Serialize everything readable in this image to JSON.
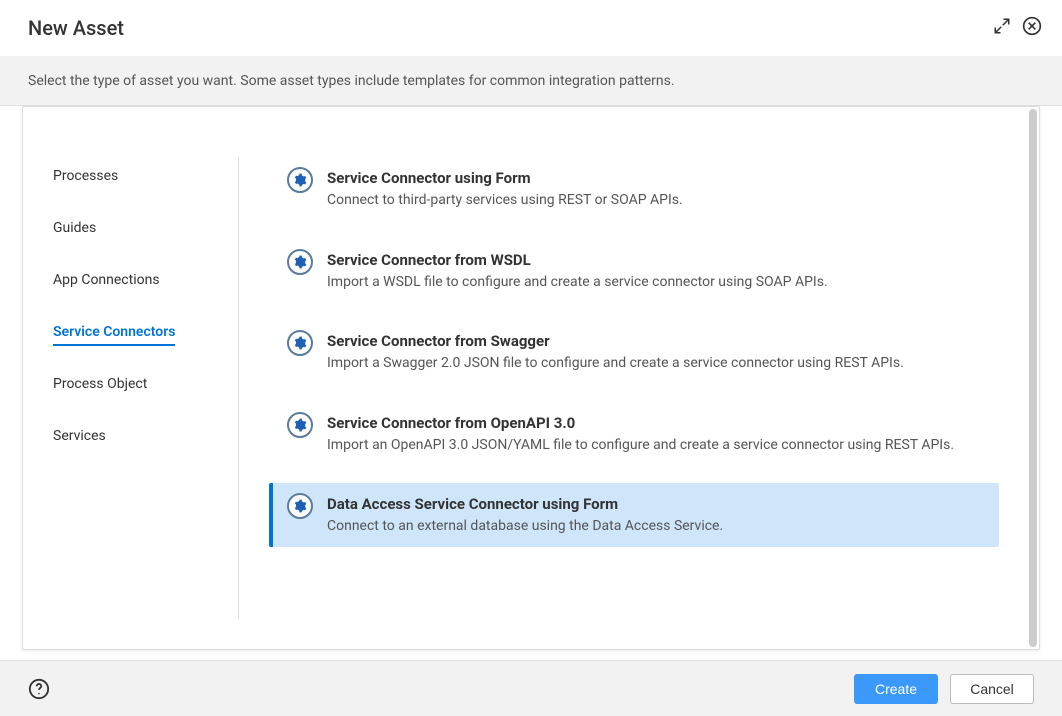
{
  "header": {
    "title": "New Asset"
  },
  "description": "Select the type of asset you want. Some asset types include templates for common integration patterns.",
  "sidebar": {
    "items": [
      {
        "label": "Processes",
        "active": false
      },
      {
        "label": "Guides",
        "active": false
      },
      {
        "label": "App Connections",
        "active": false
      },
      {
        "label": "Service Connectors",
        "active": true
      },
      {
        "label": "Process Object",
        "active": false
      },
      {
        "label": "Services",
        "active": false
      }
    ]
  },
  "items": [
    {
      "title": "Service Connector using Form",
      "desc": "Connect to third-party services using REST or SOAP APIs.",
      "selected": false
    },
    {
      "title": "Service Connector from WSDL",
      "desc": "Import a WSDL file to configure and create a service connector using SOAP APIs.",
      "selected": false
    },
    {
      "title": "Service Connector from Swagger",
      "desc": "Import a Swagger 2.0 JSON file to configure and create a service connector using REST APIs.",
      "selected": false
    },
    {
      "title": "Service Connector from OpenAPI 3.0",
      "desc": "Import an OpenAPI 3.0 JSON/YAML file to configure and create a service connector using REST APIs.",
      "selected": false
    },
    {
      "title": "Data Access Service Connector using Form",
      "desc": "Connect to an external database using the Data Access Service.",
      "selected": true
    }
  ],
  "footer": {
    "create_label": "Create",
    "cancel_label": "Cancel"
  }
}
